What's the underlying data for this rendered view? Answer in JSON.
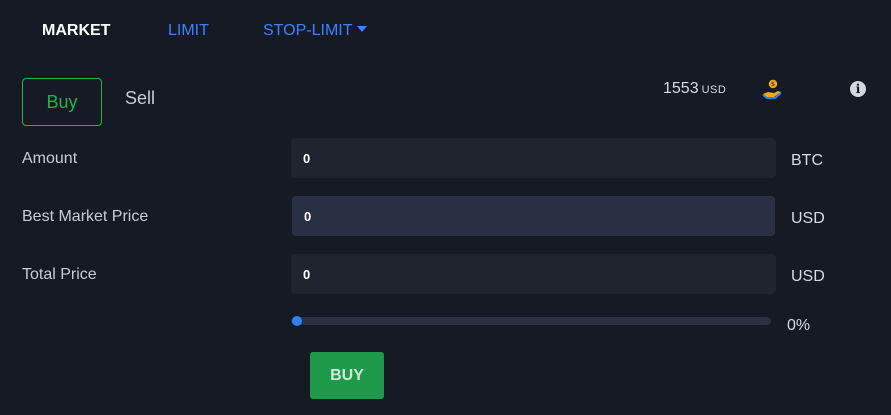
{
  "tabs": {
    "market": "MARKET",
    "limit": "LIMIT",
    "stop_limit": "STOP-LIMIT"
  },
  "side": {
    "buy": "Buy",
    "sell": "Sell"
  },
  "balance": {
    "amount": "1553",
    "currency": "USD",
    "icon": "coin-hand-icon",
    "info_icon": "info-icon"
  },
  "form": {
    "amount": {
      "label": "Amount",
      "value": "0",
      "unit": "BTC"
    },
    "best_market_price": {
      "label": "Best Market Price",
      "value": "0",
      "unit": "USD"
    },
    "total_price": {
      "label": "Total Price",
      "value": "0",
      "unit": "USD"
    }
  },
  "slider": {
    "percent_label": "0%",
    "value": 0
  },
  "submit": {
    "label": "BUY"
  },
  "colors": {
    "background": "#161a25",
    "accent_blue": "#3b82ff",
    "buy_green": "#22b24c",
    "buy_button": "#1f9a4a"
  }
}
